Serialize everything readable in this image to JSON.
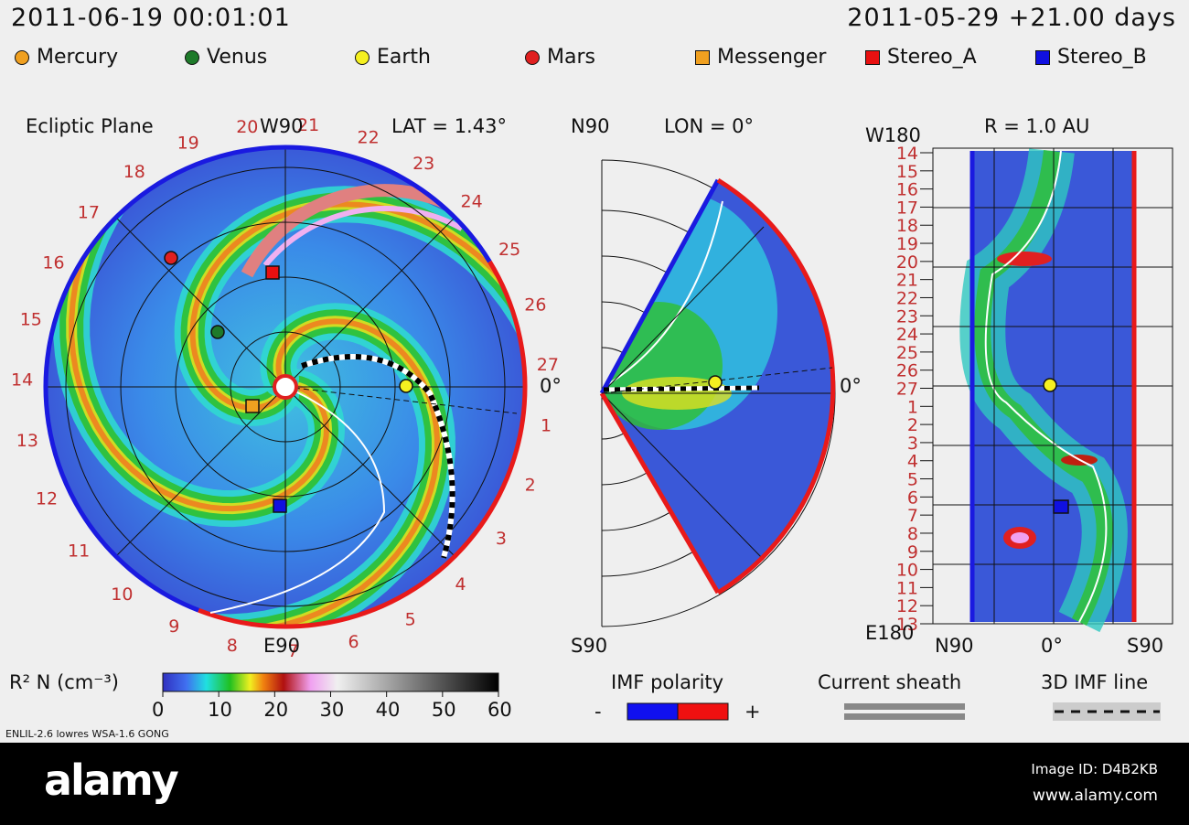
{
  "header": {
    "datetime": "2011-06-19 00:01:01",
    "run": "2011-05-29 +21.00 days"
  },
  "legend": [
    {
      "label": "Mercury",
      "shape": "circle",
      "color": "#f0a020"
    },
    {
      "label": "Venus",
      "shape": "circle",
      "color": "#1e7a2a"
    },
    {
      "label": "Earth",
      "shape": "circle",
      "color": "#f5f020"
    },
    {
      "label": "Mars",
      "shape": "circle",
      "color": "#e02020"
    },
    {
      "label": "Messenger",
      "shape": "square",
      "color": "#f0a020"
    },
    {
      "label": "Stereo_A",
      "shape": "square",
      "color": "#e81010"
    },
    {
      "label": "Stereo_B",
      "shape": "square",
      "color": "#1010e0"
    }
  ],
  "ecliptic": {
    "title": "Ecliptic Plane",
    "top": "W90",
    "bottom": "E90",
    "lat": "LAT = 1.43°",
    "zero": "0°"
  },
  "meridional": {
    "top": "N90",
    "bottom": "S90",
    "lon": "LON = 0°",
    "zero": "0°"
  },
  "radial": {
    "title": "R = 1.0 AU",
    "top": "W180",
    "bottom": "E180",
    "x_left": "N90",
    "x_mid": "0°",
    "x_right": "S90"
  },
  "carrington": [
    "27",
    "1",
    "2",
    "3",
    "4",
    "5",
    "6",
    "7",
    "8",
    "9",
    "10",
    "11",
    "12",
    "13",
    "14",
    "15",
    "16",
    "17",
    "18",
    "19",
    "20",
    "21",
    "22",
    "23",
    "24",
    "25",
    "26"
  ],
  "radial_rows": [
    "14",
    "15",
    "16",
    "17",
    "18",
    "19",
    "20",
    "21",
    "22",
    "23",
    "24",
    "25",
    "26",
    "27",
    "1",
    "2",
    "3",
    "4",
    "5",
    "6",
    "7",
    "8",
    "9",
    "10",
    "11",
    "12",
    "13"
  ],
  "chart_data": {
    "type": "heatmap",
    "title": "WSA-ENLIL solar wind density R² N",
    "colorbar": {
      "label": "R² N (cm⁻³)",
      "ticks": [
        "0",
        "10",
        "20",
        "30",
        "40",
        "50",
        "60"
      ],
      "range": [
        0,
        60
      ]
    },
    "imf_polarity": {
      "label": "IMF polarity",
      "minus": "-",
      "plus": "+",
      "colors": [
        "#1010f0",
        "#f01010"
      ]
    },
    "current_sheath": "Current sheath",
    "imf_line": "3D IMF line"
  },
  "model_info": "ENLIL-2.6 lowres WSA-1.6 GONG",
  "footer": {
    "brand": "alamy",
    "image_id": "Image ID: D4B2KB",
    "url": "www.alamy.com"
  }
}
